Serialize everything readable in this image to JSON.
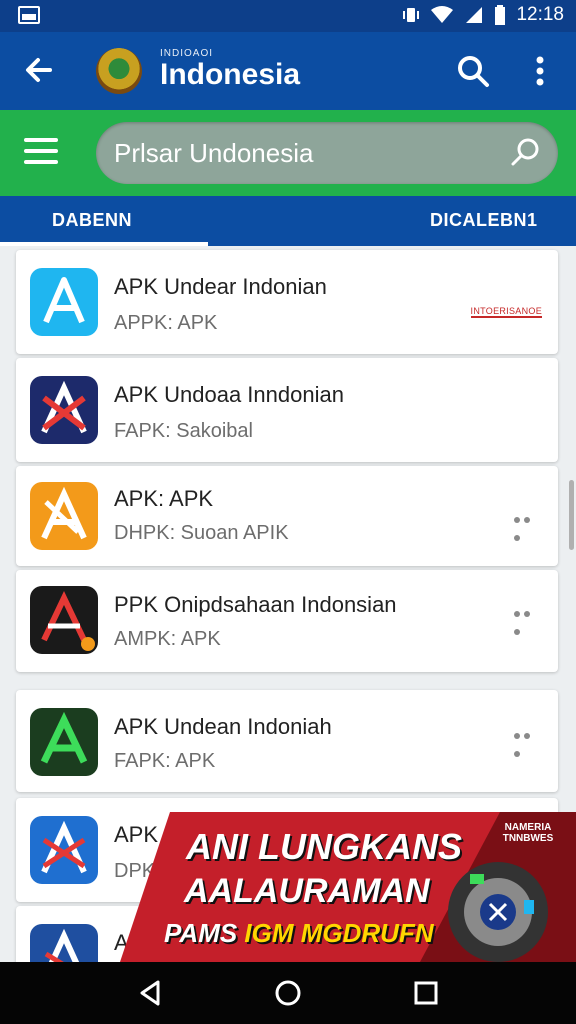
{
  "status_bar": {
    "time": "12:18"
  },
  "app_bar": {
    "logo_caption": "INDIOAOI",
    "title": "Indonesia"
  },
  "search": {
    "value": "Prlsar Undonesia"
  },
  "tabs": [
    {
      "label": "DABENN"
    },
    {
      "label": "DICALEBN1"
    }
  ],
  "apps": [
    {
      "title": "APK Undear Indonian",
      "subtitle": "APPK: APK",
      "badge": "INTOERISANOE",
      "icon_color": "#1fb6f0",
      "icon_name": "apk-icon-blue"
    },
    {
      "title": "APK Undoaa Inndonian",
      "subtitle": "FAPK: Sakoibal",
      "icon_color": "#1d2a6b",
      "icon_name": "apk-icon-red-navy"
    },
    {
      "title": "APK: APK",
      "subtitle": "DHPK: Suoan  APIK",
      "icon_color": "#f39a1a",
      "icon_name": "apk-icon-orange"
    },
    {
      "title": "PPK Onipdsahaan Indonsian",
      "subtitle": "AMPK: APK",
      "icon_color": "#1a1a1a",
      "icon_name": "apk-icon-dark"
    },
    {
      "title": "APK Undean Indoniah",
      "subtitle": "FAPK: APK",
      "icon_color": "#1b3d1f",
      "icon_name": "apk-icon-green"
    },
    {
      "title": "APK",
      "subtitle": "DPK",
      "icon_color": "#1f6fd0",
      "icon_name": "apk-icon-blue-red"
    },
    {
      "title": "A",
      "subtitle": "",
      "icon_color": "#1f4fa0",
      "icon_name": "apk-icon-partial"
    }
  ],
  "banner": {
    "line1": "ANI LUNGKANS",
    "line2": "AALAURAMAN",
    "line3_a": "PAMS ",
    "line3_b": "IGM MGDRUFN",
    "tag": "NAMERIA TNNBWES"
  },
  "colors": {
    "status_bar": "#0d3f8a",
    "app_bar": "#0c4da2",
    "search_bar": "#22b14c",
    "banner_red": "#c41f2a"
  }
}
